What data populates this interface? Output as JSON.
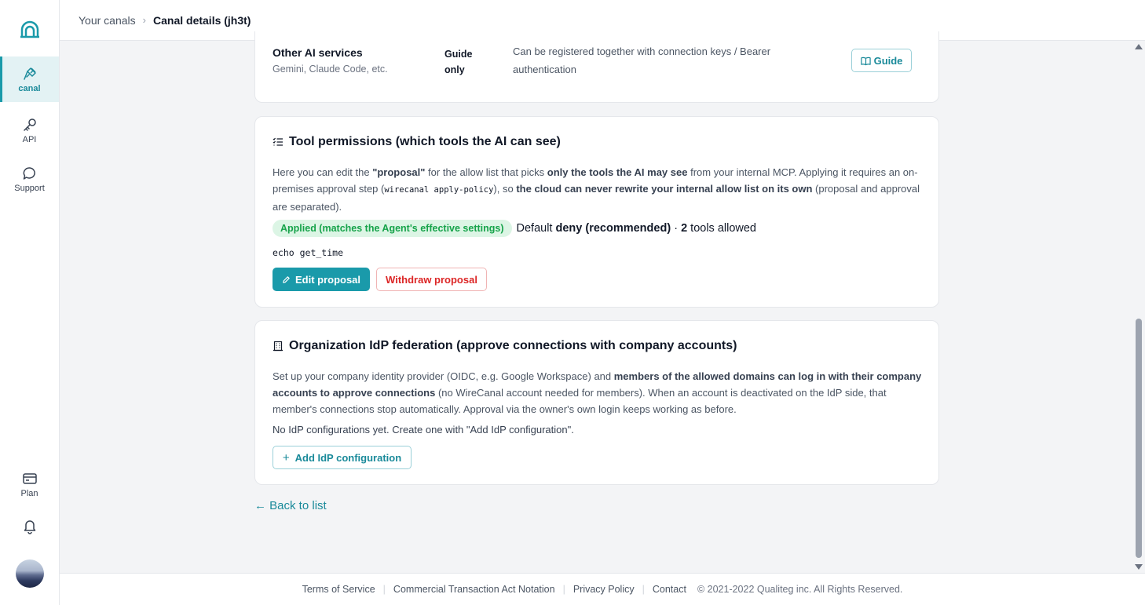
{
  "colors": {
    "accent": "#1a9aaa",
    "success": "#16a34a",
    "danger": "#dc2626"
  },
  "sidebar": {
    "items": [
      {
        "label": "canal",
        "icon": "plug-icon",
        "active": true
      },
      {
        "label": "API",
        "icon": "key-icon"
      },
      {
        "label": "Support",
        "icon": "chat-icon"
      },
      {
        "label": "Plan",
        "icon": "card-icon"
      }
    ]
  },
  "breadcrumb": {
    "parent": "Your canals",
    "current": "Canal details (jh3t)"
  },
  "services": {
    "name": "Other AI services",
    "sub": "Gemini, Claude Code, etc.",
    "status": "Guide only",
    "desc": "Can be registered together with connection keys / Bearer authentication",
    "guide_label": "Guide"
  },
  "tools": {
    "title": "Tool permissions (which tools the AI can see)",
    "p1": "Here you can edit the ",
    "p1_b": "\"proposal\"",
    "p2": " for the allow list that picks ",
    "p2_b": "only the tools the AI may see",
    "p3": " from your internal MCP. Applying it requires an on-premises approval step (",
    "p3_code": "wirecanal apply-policy",
    "p4": "), so ",
    "p4_b": "the cloud can never rewrite your internal allow list on its own",
    "p5": " (proposal and approval are separated).",
    "status_badge": "Applied (matches the Agent's effective settings)",
    "default_label": "Default",
    "default_value": "deny (recommended)",
    "dot": "·",
    "tool_count": "2",
    "tools_allowed": "tools allowed",
    "tools_list": "echo get_time",
    "edit_label": "Edit proposal",
    "withdraw_label": "Withdraw proposal"
  },
  "idp": {
    "title": "Organization IdP federation (approve connections with company accounts)",
    "p1": "Set up your company identity provider (OIDC, e.g. Google Workspace) and ",
    "p1_b": "members of the allowed domains can log in with their company accounts to approve connections",
    "p2": " (no WireCanal account needed for members). When an account is deactivated on the IdP side, that member's connections stop automatically. Approval via the owner's own login keeps working as before.",
    "empty": "No IdP configurations yet. Create one with \"Add IdP configuration\".",
    "add_label": "Add IdP configuration"
  },
  "back_link": "← Back to list",
  "footer": {
    "links": [
      "Terms of Service",
      "Commercial Transaction Act Notation",
      "Privacy Policy",
      "Contact"
    ],
    "copyright": "© 2021-2022 Qualiteg inc. All Rights Reserved."
  }
}
